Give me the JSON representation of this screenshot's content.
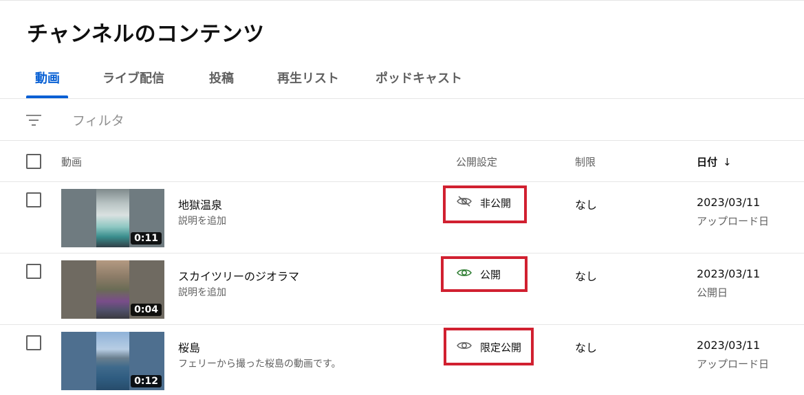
{
  "page": {
    "title": "チャンネルのコンテンツ"
  },
  "tabs": [
    {
      "label": "動画",
      "active": true
    },
    {
      "label": "ライブ配信",
      "active": false
    },
    {
      "label": "投稿",
      "active": false
    },
    {
      "label": "再生リスト",
      "active": false
    },
    {
      "label": "ポッドキャスト",
      "active": false
    }
  ],
  "filter": {
    "icon": "filter-icon",
    "placeholder": "フィルタ"
  },
  "table": {
    "headers": {
      "video": "動画",
      "visibility": "公開設定",
      "restrictions": "制限",
      "date": "日付",
      "sort_icon": "↓"
    },
    "rows": [
      {
        "title": "地獄温泉",
        "description": "説明を追加",
        "duration": "0:11",
        "visibility": "非公開",
        "visibility_icon": "eye-off-icon",
        "restriction": "なし",
        "date": "2023/03/11",
        "date_label": "アップロード日"
      },
      {
        "title": "スカイツリーのジオラマ",
        "description": "説明を追加",
        "duration": "0:04",
        "visibility": "公開",
        "visibility_icon": "eye-icon",
        "restriction": "なし",
        "date": "2023/03/11",
        "date_label": "公開日"
      },
      {
        "title": "桜島",
        "description": "フェリーから撮った桜島の動画です。",
        "duration": "0:12",
        "visibility": "限定公開",
        "visibility_icon": "eye-icon",
        "restriction": "なし",
        "date": "2023/03/11",
        "date_label": "アップロード日"
      }
    ]
  },
  "colors": {
    "accent": "#065fd4",
    "highlight_box": "#d12030",
    "public_eye": "#2e7d32"
  }
}
